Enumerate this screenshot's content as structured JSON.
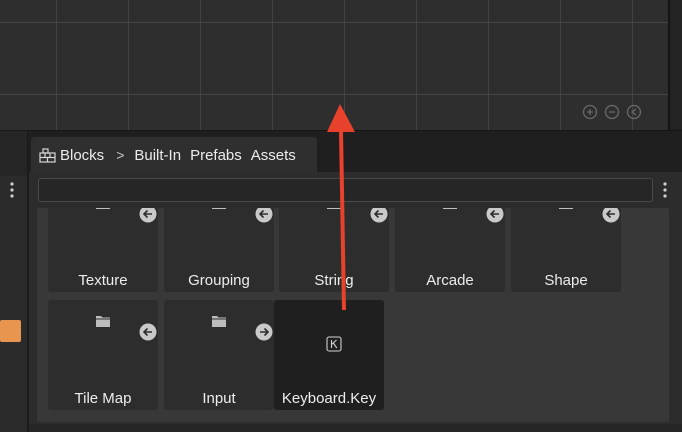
{
  "breadcrumb": {
    "root": "Blocks",
    "separator": ">",
    "items": [
      "Built-In",
      "Prefabs",
      "Assets"
    ]
  },
  "search": {
    "value": "",
    "placeholder": ""
  },
  "tiles": [
    {
      "label": "Texture",
      "icon": "folder-icon",
      "action": "arrow-left-icon"
    },
    {
      "label": "Grouping",
      "icon": "folder-icon",
      "action": "arrow-left-icon"
    },
    {
      "label": "String",
      "icon": "folder-icon",
      "action": "arrow-left-icon"
    },
    {
      "label": "Arcade",
      "icon": "folder-icon",
      "action": "arrow-left-icon"
    },
    {
      "label": "Shape",
      "icon": "folder-icon",
      "action": "arrow-left-icon"
    },
    {
      "label": "Tile Map",
      "icon": "folder-icon",
      "action": "arrow-left-icon"
    },
    {
      "label": "Input",
      "icon": "folder-icon",
      "action": "arrow-right-icon"
    },
    {
      "label": "Keyboard.Key",
      "icon": "key-k-icon"
    }
  ],
  "zoom_controls": [
    "zoom-in-icon",
    "zoom-out-icon",
    "zoom-reset-icon"
  ],
  "colors": {
    "accent_orange": "#e8954f",
    "annotation_red": "#e8412c",
    "tile_bg": "#2d2d2d",
    "panel_bg": "#2c2c2c"
  }
}
